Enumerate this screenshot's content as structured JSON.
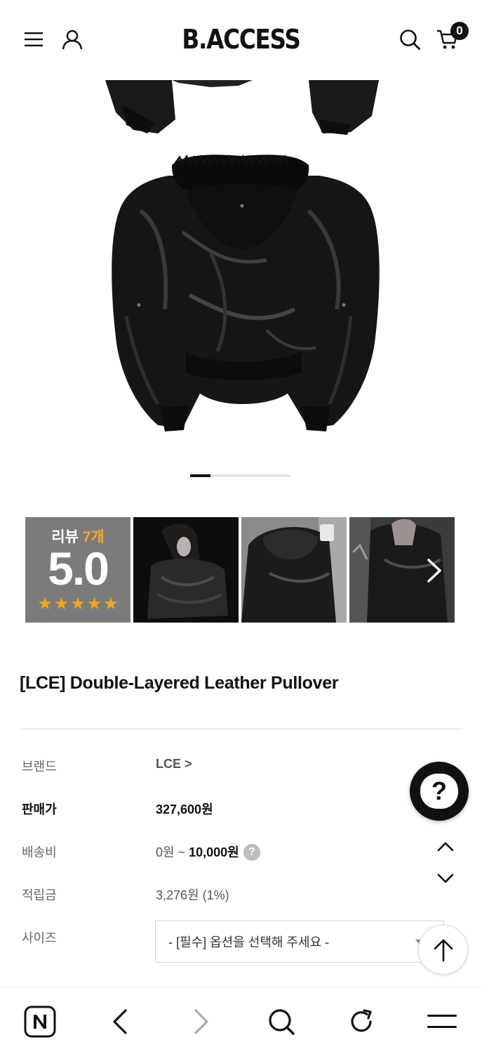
{
  "header": {
    "logo": "B.ACCESS",
    "cart_count": "0"
  },
  "gallery": {
    "slide_count": 10,
    "active_slide": 1
  },
  "review": {
    "label": "리뷰",
    "count": "7개",
    "score": "5.0",
    "stars": 5,
    "star_color": "#f5a623"
  },
  "product": {
    "title": "[LCE] Double-Layered Leather Pullover"
  },
  "info": {
    "brand_label": "브랜드",
    "brand_value": "LCE >",
    "price_label": "판매가",
    "price_value": "327,600원",
    "shipping_label": "배송비",
    "shipping_min": "0원 ~ ",
    "shipping_max": "10,000원",
    "shipping_help": "?",
    "points_label": "적립금",
    "points_value": "3,276원 (1%)",
    "size_label": "사이즈",
    "size_placeholder": "- [필수] 옵션을 선택해 주세요 -"
  },
  "floating": {
    "help_icon": "?"
  },
  "icons": {
    "menu": "hamburger-icon",
    "account": "user-icon",
    "search": "search-icon",
    "cart": "cart-icon"
  }
}
